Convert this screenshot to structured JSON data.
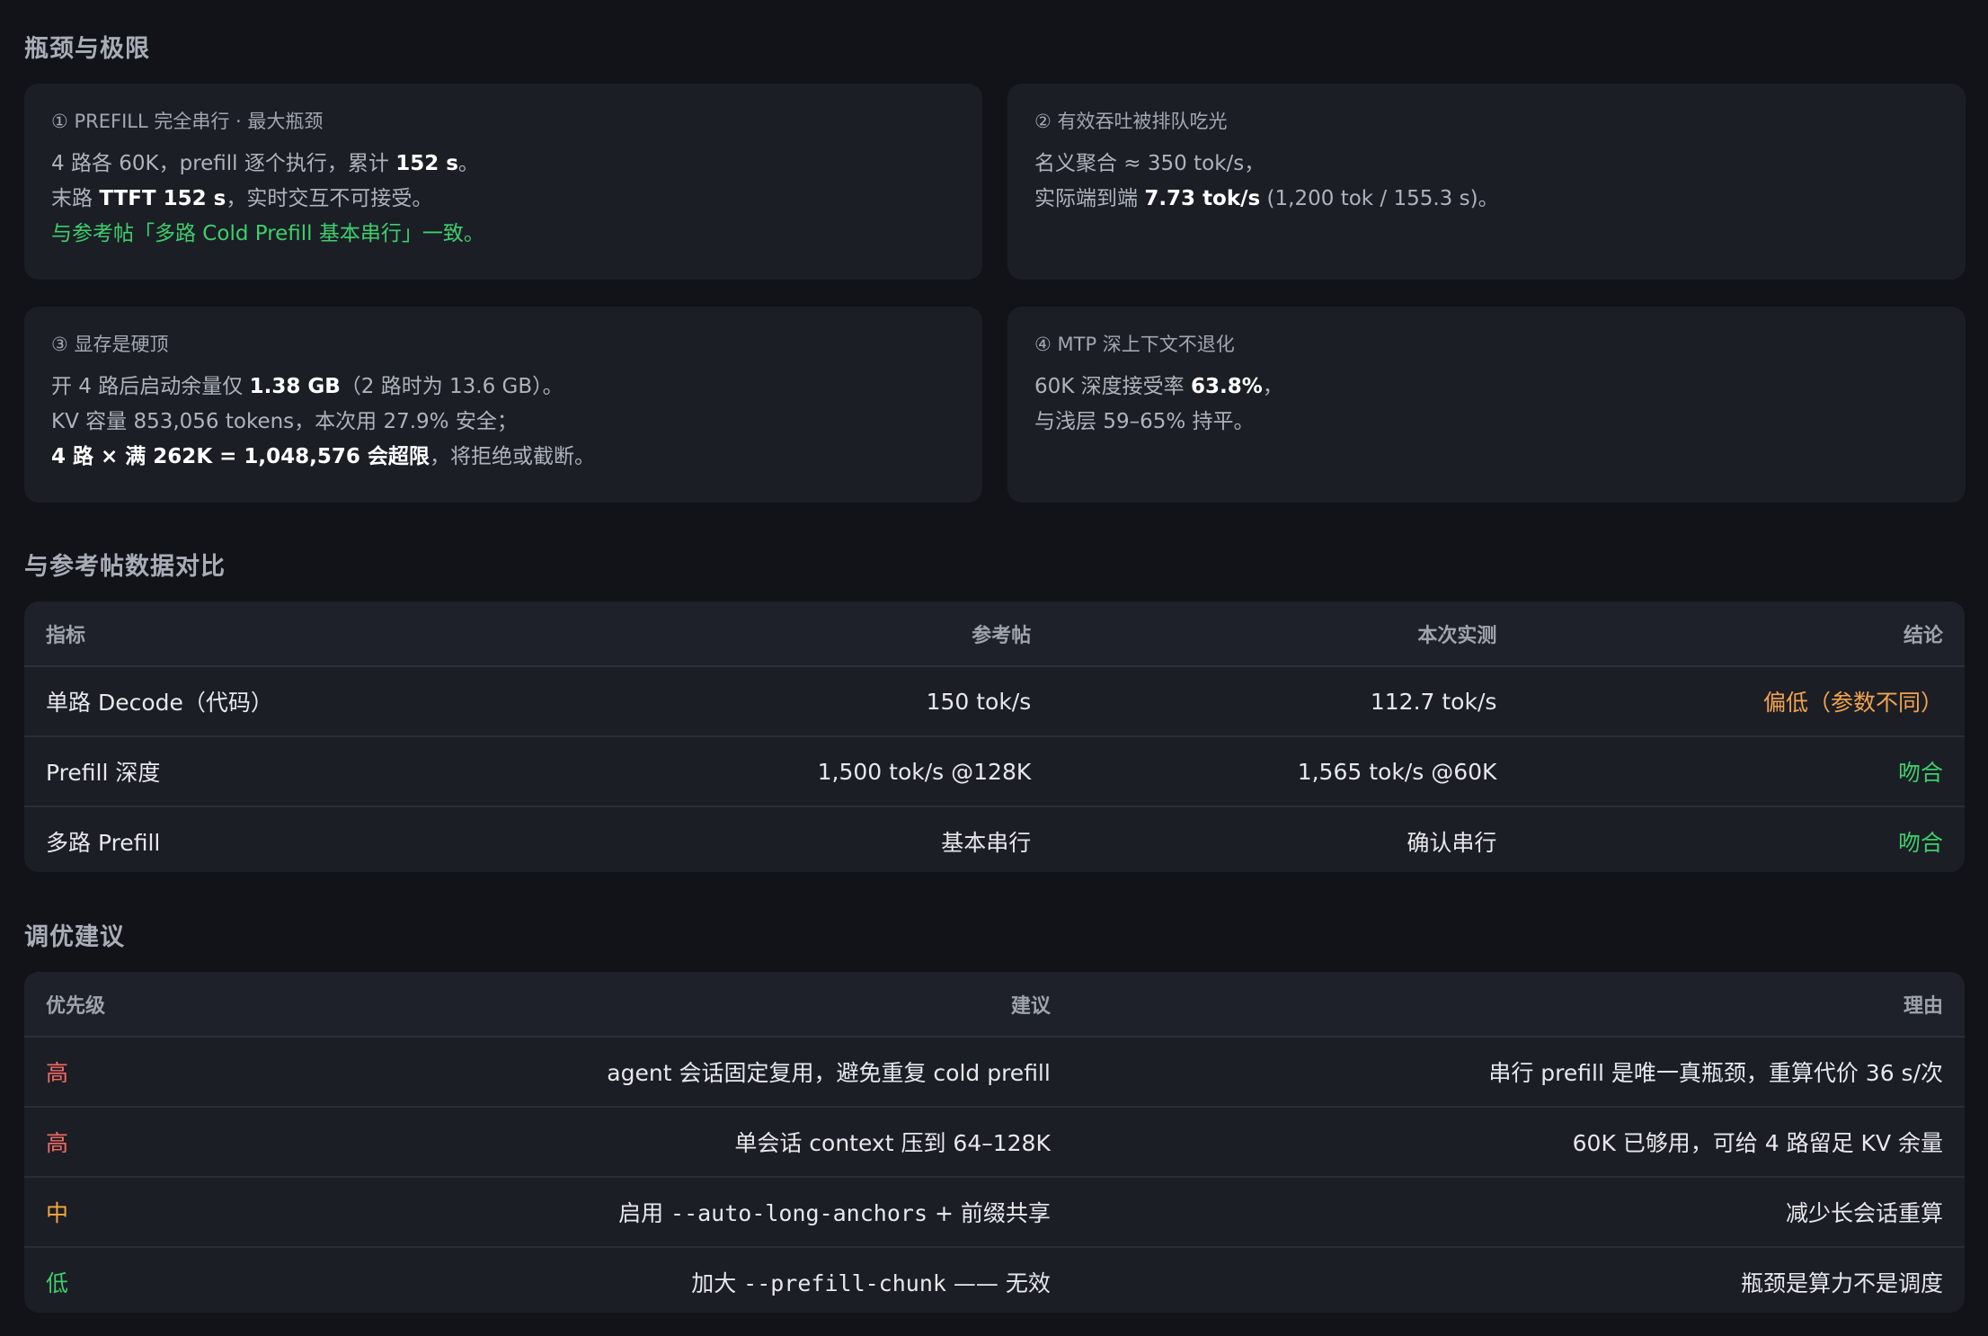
{
  "sections": {
    "bottlenecks_title": "瓶颈与极限",
    "compare_title": "与参考帖数据对比",
    "tuning_title": "调优建议"
  },
  "cards": [
    {
      "title": "① PREFILL 完全串行 · 最大瓶颈",
      "lines": [
        {
          "pre": "4 路各 60K，prefill 逐个执行，累计 ",
          "bold": "152 s",
          "post": "。"
        },
        {
          "pre": "末路 ",
          "bold": "TTFT 152 s",
          "post": "，实时交互不可接受。"
        },
        {
          "green": "与参考帖「多路 Cold Prefill 基本串行」一致。"
        }
      ]
    },
    {
      "title": "② 有效吞吐被排队吃光",
      "lines": [
        {
          "pre": "名义聚合 ≈ 350 tok/s，"
        },
        {
          "pre": "实际端到端 ",
          "bold": "7.73 tok/s",
          "post": " (1,200 tok / 155.3 s)。"
        }
      ]
    },
    {
      "title": "③ 显存是硬顶",
      "lines": [
        {
          "pre": "开 4 路后启动余量仅 ",
          "bold": "1.38 GB",
          "post": "（2 路时为 13.6 GB）。"
        },
        {
          "pre": "KV 容量 853,056 tokens，本次用 27.9% 安全；"
        },
        {
          "bold": "4 路 × 满 262K = 1,048,576 会超限",
          "post": "，将拒绝或截断。"
        }
      ]
    },
    {
      "title": "④ MTP 深上下文不退化",
      "lines": [
        {
          "pre": "60K 深度接受率 ",
          "bold": "63.8%",
          "post": "，"
        },
        {
          "pre": "与浅层 59–65% 持平。"
        }
      ]
    }
  ],
  "compare_table": {
    "headers": [
      "指标",
      "参考帖",
      "本次实测",
      "结论"
    ],
    "rows": [
      [
        "单路 Decode（代码）",
        "150 tok/s",
        "112.7 tok/s",
        "偏低（参数不同）"
      ],
      [
        "Prefill 深度",
        "1,500 tok/s @128K",
        "1,565 tok/s @60K",
        "吻合"
      ],
      [
        "多路 Prefill",
        "基本串行",
        "确认串行",
        "吻合"
      ]
    ],
    "conclusion_colors": [
      "#f3a34d",
      "#3fce6c",
      "#3fce6c"
    ]
  },
  "tuning_table": {
    "headers": [
      "优先级",
      "建议",
      "理由"
    ],
    "rows": [
      {
        "priority": "高",
        "suggestion_pre": "agent 会话固定复用，避免重复 cold prefill",
        "reason": "串行 prefill 是唯一真瓶颈，重算代价 36 s/次"
      },
      {
        "priority": "高",
        "suggestion_pre": "单会话 context 压到 64–128K",
        "reason": "60K 已够用，可给 4 路留足 KV 余量"
      },
      {
        "priority": "中",
        "suggestion_pre": "启用 ",
        "suggestion_code": "--auto-long-anchors",
        "suggestion_post": " + 前缀共享",
        "reason": "减少长会话重算"
      },
      {
        "priority": "低",
        "suggestion_pre": "加大 ",
        "suggestion_code": "--prefill-chunk",
        "suggestion_post": " —— 无效",
        "reason": "瓶颈是算力不是调度"
      }
    ],
    "priority_colors": [
      "#f26b63",
      "#f26b63",
      "#f3a83e",
      "#3fce6c"
    ]
  }
}
